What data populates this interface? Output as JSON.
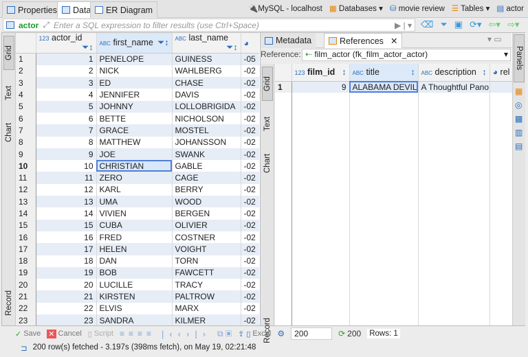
{
  "editor_tabs": [
    {
      "label": "Properties"
    },
    {
      "label": "Data",
      "active": true
    },
    {
      "label": "ER Diagram"
    }
  ],
  "breadcrumb": {
    "connection": "MySQL - localhost",
    "databases": "Databases",
    "database": "movie review",
    "tables": "Tables",
    "table": "actor"
  },
  "filter": {
    "table": "actor",
    "placeholder": "Enter a SQL expression to filter results (use Ctrl+Space)"
  },
  "main_grid": {
    "columns": [
      "actor_id",
      "first_name",
      "last_name"
    ],
    "partial_col_value_first": "-05",
    "partial_col_value": "-02",
    "rows": [
      [
        1,
        "PENELOPE",
        "GUINESS"
      ],
      [
        2,
        "NICK",
        "WAHLBERG"
      ],
      [
        3,
        "ED",
        "CHASE"
      ],
      [
        4,
        "JENNIFER",
        "DAVIS"
      ],
      [
        5,
        "JOHNNY",
        "LOLLOBRIGIDA"
      ],
      [
        6,
        "BETTE",
        "NICHOLSON"
      ],
      [
        7,
        "GRACE",
        "MOSTEL"
      ],
      [
        8,
        "MATTHEW",
        "JOHANSSON"
      ],
      [
        9,
        "JOE",
        "SWANK"
      ],
      [
        10,
        "CHRISTIAN",
        "GABLE"
      ],
      [
        11,
        "ZERO",
        "CAGE"
      ],
      [
        12,
        "KARL",
        "BERRY"
      ],
      [
        13,
        "UMA",
        "WOOD"
      ],
      [
        14,
        "VIVIEN",
        "BERGEN"
      ],
      [
        15,
        "CUBA",
        "OLIVIER"
      ],
      [
        16,
        "FRED",
        "COSTNER"
      ],
      [
        17,
        "HELEN",
        "VOIGHT"
      ],
      [
        18,
        "DAN",
        "TORN"
      ],
      [
        19,
        "BOB",
        "FAWCETT"
      ],
      [
        20,
        "LUCILLE",
        "TRACY"
      ],
      [
        21,
        "KIRSTEN",
        "PALTROW"
      ],
      [
        22,
        "ELVIS",
        "MARX"
      ],
      [
        23,
        "SANDRA",
        "KILMER"
      ]
    ]
  },
  "view_tabs": [
    "Grid",
    "Text",
    "Chart",
    "Record"
  ],
  "side_panel": {
    "tabs": [
      "Metadata",
      "References"
    ],
    "reference_label": "Reference:",
    "reference_value": "film_actor (fk_film_actor_actor)",
    "columns": [
      "film_id",
      "title",
      "description",
      "rel"
    ],
    "rows": [
      {
        "n": "1",
        "film_id": 9,
        "title": "ALABAMA DEVIL",
        "description": "A Thoughtful Pano"
      }
    ]
  },
  "panels_label": "Panels",
  "toolbar": {
    "save": "Save",
    "cancel": "Cancel",
    "script": "Script",
    "excel": "Excel",
    "fetch_size": "200",
    "fetched_count": "200",
    "rows": "Rows: 1"
  },
  "status": "200 row(s) fetched - 3.197s (398ms fetch), on May 19, 02:21:48"
}
